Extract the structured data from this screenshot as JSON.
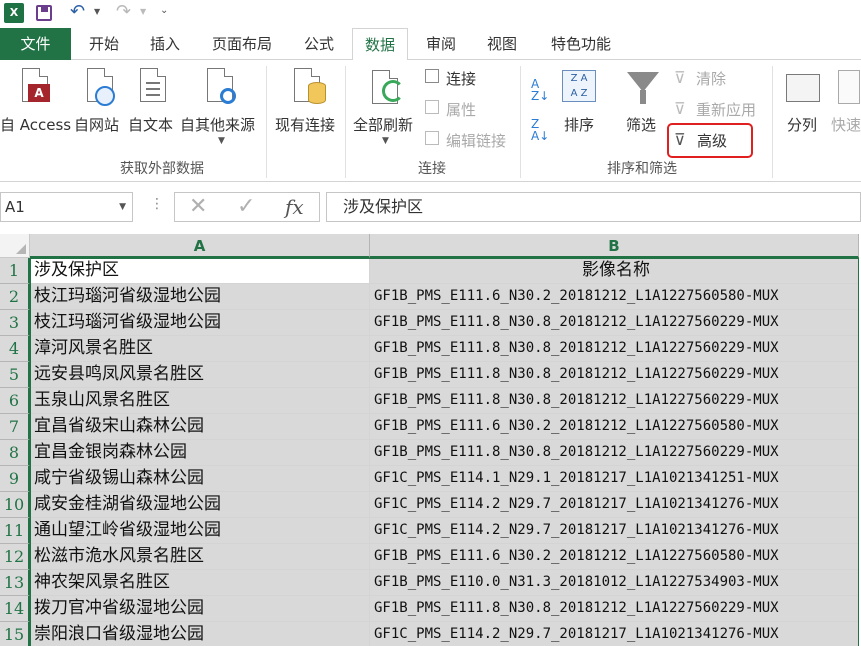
{
  "quick_access": {
    "app_icon": "X",
    "icons": [
      "excel-icon",
      "save-icon",
      "undo-icon",
      "redo-icon",
      "customize-icon"
    ]
  },
  "tabs": [
    "文件",
    "开始",
    "插入",
    "页面布局",
    "公式",
    "数据",
    "审阅",
    "视图",
    "特色功能"
  ],
  "active_tab": "数据",
  "ribbon": {
    "external": {
      "access": "自 Access",
      "web": "自网站",
      "text": "自文本",
      "other": "自其他来源",
      "existing": "现有连接",
      "group": "获取外部数据"
    },
    "connections": {
      "refresh_all": "全部刷新",
      "connections": "连接",
      "properties": "属性",
      "edit_links": "编辑链接",
      "group": "连接"
    },
    "sort_filter": {
      "sort": "排序",
      "filter": "筛选",
      "clear": "清除",
      "reapply": "重新应用",
      "advanced": "高级",
      "group": "排序和筛选",
      "highlight_color": "#e02020"
    },
    "tools": {
      "text_to_columns": "分列",
      "flash_fill": "快速"
    }
  },
  "formula_bar": {
    "name_box": "A1",
    "formula": "涉及保护区",
    "fx": "fx"
  },
  "grid": {
    "columns": [
      "A",
      "B"
    ],
    "rows": [
      {
        "n": "1",
        "a": "涉及保护区",
        "b": "影像名称"
      },
      {
        "n": "2",
        "a": "枝江玛瑙河省级湿地公园",
        "b": "GF1B_PMS_E111.6_N30.2_20181212_L1A1227560580-MUX"
      },
      {
        "n": "3",
        "a": "枝江玛瑙河省级湿地公园",
        "b": "GF1B_PMS_E111.8_N30.8_20181212_L1A1227560229-MUX"
      },
      {
        "n": "4",
        "a": "漳河风景名胜区",
        "b": "GF1B_PMS_E111.8_N30.8_20181212_L1A1227560229-MUX"
      },
      {
        "n": "5",
        "a": "远安县鸣凤风景名胜区",
        "b": "GF1B_PMS_E111.8_N30.8_20181212_L1A1227560229-MUX"
      },
      {
        "n": "6",
        "a": "玉泉山风景名胜区",
        "b": "GF1B_PMS_E111.8_N30.8_20181212_L1A1227560229-MUX"
      },
      {
        "n": "7",
        "a": "宜昌省级宋山森林公园",
        "b": "GF1B_PMS_E111.6_N30.2_20181212_L1A1227560580-MUX"
      },
      {
        "n": "8",
        "a": "宜昌金银岗森林公园",
        "b": "GF1B_PMS_E111.8_N30.8_20181212_L1A1227560229-MUX"
      },
      {
        "n": "9",
        "a": "咸宁省级锡山森林公园",
        "b": "GF1C_PMS_E114.1_N29.1_20181217_L1A1021341251-MUX"
      },
      {
        "n": "10",
        "a": "咸安金桂湖省级湿地公园",
        "b": "GF1C_PMS_E114.2_N29.7_20181217_L1A1021341276-MUX"
      },
      {
        "n": "11",
        "a": "通山望江岭省级湿地公园",
        "b": "GF1C_PMS_E114.2_N29.7_20181217_L1A1021341276-MUX"
      },
      {
        "n": "12",
        "a": "松滋市洈水风景名胜区",
        "b": "GF1B_PMS_E111.6_N30.2_20181212_L1A1227560580-MUX"
      },
      {
        "n": "13",
        "a": "神农架风景名胜区",
        "b": "GF1B_PMS_E110.0_N31.3_20181012_L1A1227534903-MUX"
      },
      {
        "n": "14",
        "a": "拨刀官冲省级湿地公园",
        "b": "GF1B_PMS_E111.8_N30.8_20181212_L1A1227560229-MUX"
      },
      {
        "n": "15",
        "a": "崇阳浪口省级湿地公园",
        "b": "GF1C_PMS_E114.2_N29.7_20181217_L1A1021341276-MUX"
      }
    ]
  }
}
